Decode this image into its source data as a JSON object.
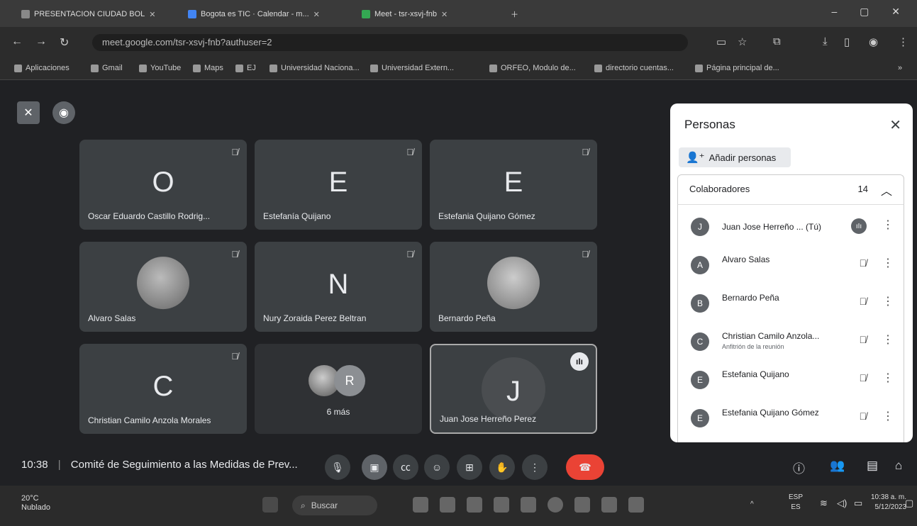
{
  "browser": {
    "tabs": [
      {
        "label": "PRESENTACION CIUDAD BOL"
      },
      {
        "label": "Bogota es TIC · Calendar - m..."
      },
      {
        "label": "Meet - tsr-xsvj-fnb"
      }
    ],
    "url": "meet.google.com/tsr-xsvj-fnb?authuser=2",
    "bookmarks": [
      "Aplicaciones",
      "Gmail",
      "YouTube",
      "Maps",
      "EJ",
      "Universidad Naciona...",
      "Universidad Extern...",
      "ORFEO, Modulo de...",
      "directorio cuentas...",
      "Página principal de..."
    ]
  },
  "tiles": [
    {
      "letter": "O",
      "name": "Oscar Eduardo Castillo Rodrig..."
    },
    {
      "letter": "E",
      "name": "Estefanía Quijano"
    },
    {
      "letter": "E",
      "name": "Estefania Quijano Gómez"
    },
    {
      "letter": "",
      "name": "Alvaro Salas"
    },
    {
      "letter": "N",
      "name": "Nury Zoraida Perez Beltran"
    },
    {
      "letter": "",
      "name": "Bernardo Peña"
    },
    {
      "letter": "C",
      "name": "Christian Camilo Anzola Morales"
    },
    {
      "letter": "R",
      "name": "6 más"
    },
    {
      "letter": "J",
      "name": "Juan Jose Herreño Perez"
    }
  ],
  "panel": {
    "title": "Personas",
    "add_label": "Añadir personas",
    "section_label": "Colaboradores",
    "section_count": "14",
    "people": [
      {
        "initial": "J",
        "name": "Juan Jose Herreño ...  (Tú)",
        "sub": ""
      },
      {
        "initial": "A",
        "name": "Alvaro Salas",
        "sub": ""
      },
      {
        "initial": "B",
        "name": "Bernardo Peña",
        "sub": ""
      },
      {
        "initial": "C",
        "name": "Christian Camilo Anzola...",
        "sub": "Anfitrión de la reunión"
      },
      {
        "initial": "E",
        "name": "Estefania Quijano",
        "sub": ""
      },
      {
        "initial": "E",
        "name": "Estefania Quijano Gómez",
        "sub": ""
      }
    ]
  },
  "meeting": {
    "time": "10:38",
    "title": "Comité de Seguimiento a las Medidas de Prev..."
  },
  "taskbar": {
    "weather_temp": "20°C",
    "weather_desc": "Nublado",
    "search_placeholder": "Buscar",
    "lang_top": "ESP",
    "lang_bottom": "ES",
    "clock_time": "10:38 a. m.",
    "clock_date": "5/12/2023"
  }
}
